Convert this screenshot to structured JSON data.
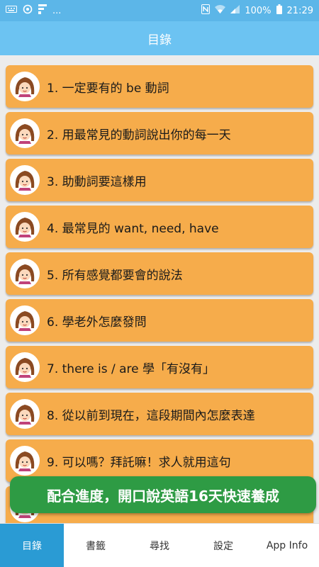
{
  "status_bar": {
    "battery": "100%",
    "time": "21:29",
    "more_indicator": "..."
  },
  "header": {
    "title": "目錄"
  },
  "items": [
    {
      "label": "1. 一定要有的 be 動詞"
    },
    {
      "label": "2. 用最常見的動詞說出你的每一天"
    },
    {
      "label": "3. 助動詞要這樣用"
    },
    {
      "label": "4. 最常見的 want, need, have"
    },
    {
      "label": "5. 所有感覺都要會的說法"
    },
    {
      "label": "6. 學老外怎麼發問"
    },
    {
      "label": "7. there is / are 學「有沒有」"
    },
    {
      "label": "8. 從以前到現在，這段期間內怎麼表達"
    },
    {
      "label": "9. 可以嗎？拜託嘛！求人就用這句"
    }
  ],
  "promo_banner": {
    "text": "配合進度，開口說英語16天快速養成"
  },
  "tabs": [
    {
      "label": "目錄",
      "active": true
    },
    {
      "label": "書籤",
      "active": false
    },
    {
      "label": "尋找",
      "active": false
    },
    {
      "label": "設定",
      "active": false
    },
    {
      "label": "App Info",
      "active": false
    }
  ],
  "colors": {
    "app_bar": "#6cc3f2",
    "status_bar": "#5cb6e8",
    "item_bg": "#f6ac4b",
    "active_tab": "#2a9bd4",
    "promo_bg": "#2e9b44"
  }
}
